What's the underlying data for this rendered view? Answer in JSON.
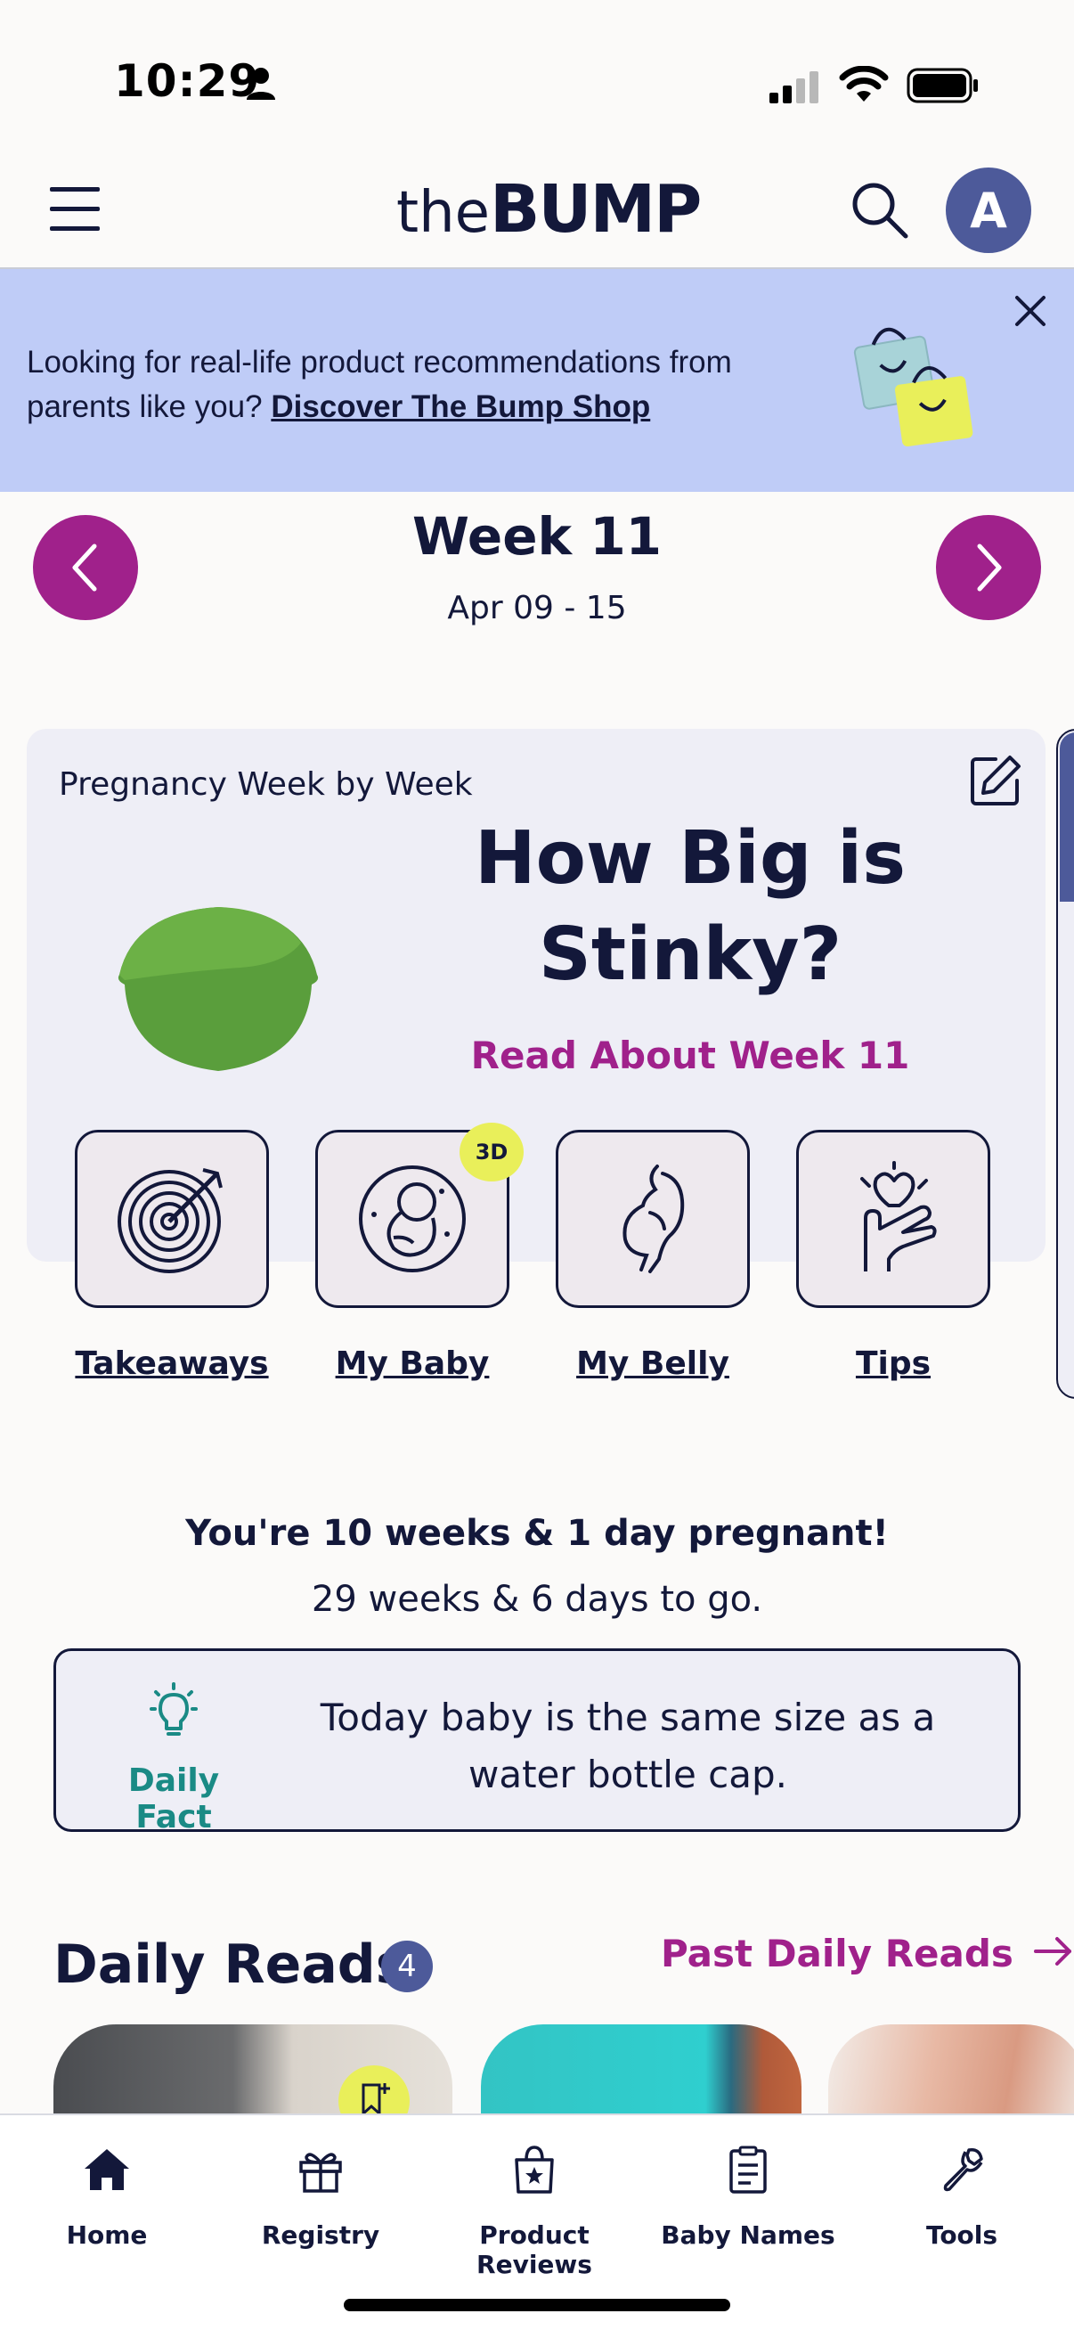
{
  "status_bar": {
    "time": "10:29"
  },
  "header": {
    "logo_the": "the",
    "logo_bump": "BUMP",
    "avatar_initial": "A"
  },
  "banner": {
    "text": "Looking for real-life product recommendations from parents like you?",
    "link": "Discover The Bump Shop"
  },
  "week_nav": {
    "title": "Week 11",
    "range": "Apr 09 - 15"
  },
  "card": {
    "label": "Pregnancy Week by Week",
    "heading": "How Big is Stinky?",
    "read_link": "Read About Week 11",
    "badge": "3D",
    "tools": [
      {
        "label": "Takeaways",
        "icon": "target-icon"
      },
      {
        "label": "My Baby",
        "icon": "fetus-icon"
      },
      {
        "label": "My Belly",
        "icon": "belly-icon"
      },
      {
        "label": "Tips",
        "icon": "heart-hand-icon"
      }
    ]
  },
  "pregnancy": {
    "status": "You're 10 weeks & 1 day pregnant!",
    "remaining": "29 weeks & 6 days to go."
  },
  "daily_fact": {
    "label": "Daily Fact",
    "text": "Today baby is the same size as a water bottle cap."
  },
  "daily_reads": {
    "title": "Daily Reads",
    "count": "4",
    "past_link": "Past Daily Reads"
  },
  "tabbar": {
    "tabs": [
      {
        "label": "Home",
        "icon": "home-icon"
      },
      {
        "label": "Registry",
        "icon": "gift-icon"
      },
      {
        "label": "Product Reviews",
        "icon": "star-bag-icon"
      },
      {
        "label": "Baby Names",
        "icon": "list-icon"
      },
      {
        "label": "Tools",
        "icon": "wrench-icon"
      }
    ]
  },
  "colors": {
    "brand_magenta": "#a0218b",
    "navy": "#13183a",
    "teal": "#1a8a85",
    "banner_bg": "#bfccf7",
    "accent_yellow": "#e9ef5a"
  }
}
